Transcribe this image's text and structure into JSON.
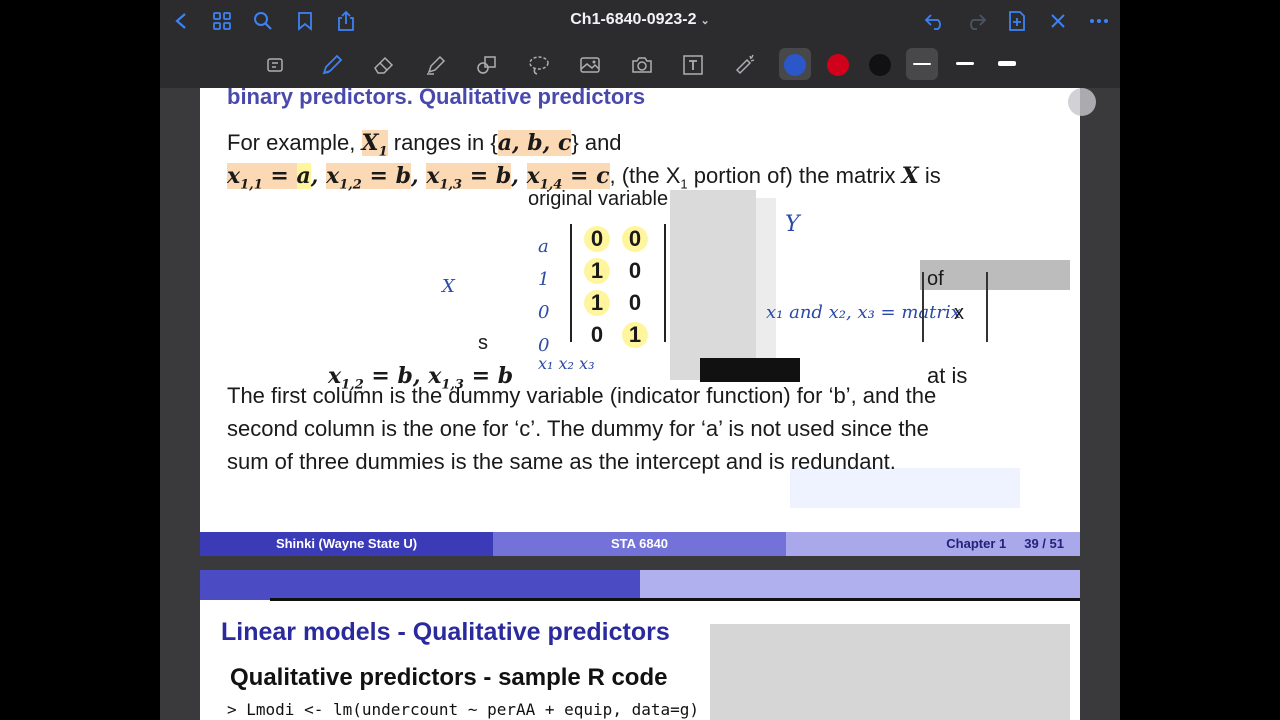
{
  "app": {
    "document_title": "Ch1-6840-0923-2"
  },
  "topbar_icons": [
    "back-icon",
    "grid-icon",
    "search-icon",
    "bookmark-icon",
    "share-icon",
    "undo-icon",
    "redo-icon",
    "add-page-icon",
    "close-icon",
    "more-icon"
  ],
  "toolbar": {
    "tools": [
      "lasso-shapes-icon",
      "pen-icon",
      "eraser-icon",
      "highlighter-icon",
      "shapes-icon",
      "lasso-icon",
      "image-icon",
      "camera-icon",
      "text-icon",
      "laser-pointer-icon"
    ],
    "colors": [
      "#2b57c9",
      "#d0021b",
      "#111111"
    ],
    "selected_color_index": 0,
    "stroke_widths": [
      "thin",
      "medium",
      "thick"
    ],
    "selected_stroke_index": 0
  },
  "slide1": {
    "header_fragment": "binary predictors. Qualitative predictors",
    "line1": {
      "pre": "For example, ",
      "var": "X",
      "sub": "1",
      "mid": " ranges in {",
      "set": "a, b, c",
      "post": "} and"
    },
    "line2": {
      "math": "x",
      "terms": [
        {
          "sub": "1,1",
          "val": "a"
        },
        {
          "sub": "1,2",
          "val": "b"
        },
        {
          "sub": "1,3",
          "val": "b"
        },
        {
          "sub": "1,4",
          "val": "c"
        }
      ],
      "tail": ", (the X",
      "tail_sub": "1",
      "tail2": " portion of) the matrix ",
      "matrix_var": "X",
      "tail3": " is"
    },
    "partial_label": "original variable",
    "matrix_rows": [
      [
        "0",
        "0"
      ],
      [
        "1",
        "0"
      ],
      [
        "1",
        "0"
      ],
      [
        "0",
        "1"
      ]
    ],
    "annotations": {
      "left_col": [
        "a",
        "1",
        "0",
        "0"
      ],
      "x_left": "X",
      "s_label": "s",
      "y_label": "Y",
      "x_eq": "x₁ and x₂, x₃ = matrix",
      "bottom_x": "x₁ x₂ x₃",
      "of_label": "of",
      "matrix_label": "x"
    },
    "ghost_line": {
      "text": "x",
      "sub1": "1,2",
      "val1": "b",
      "sub2": "1,3",
      "val2": "b",
      "tail": "at",
      "tail2": "is"
    },
    "paragraph": [
      "The first column is the dummy variable (indicator function) for ‘b’, and the",
      "second column is the one for ‘c’. The dummy for ‘a’ is not used since the",
      "sum of three dummies is the same as the intercept and is redundant."
    ]
  },
  "footer1": {
    "author": "Shinki  (Wayne State U)",
    "course": "STA 6840",
    "chapter": "Chapter 1",
    "page": "39 / 51"
  },
  "slide2": {
    "title": "Linear models - Qualitative predictors",
    "subtitle": "Qualitative predictors - sample R code",
    "code": "> Lmodi <- lm(undercount ~ perAA + equip, data=g)"
  }
}
